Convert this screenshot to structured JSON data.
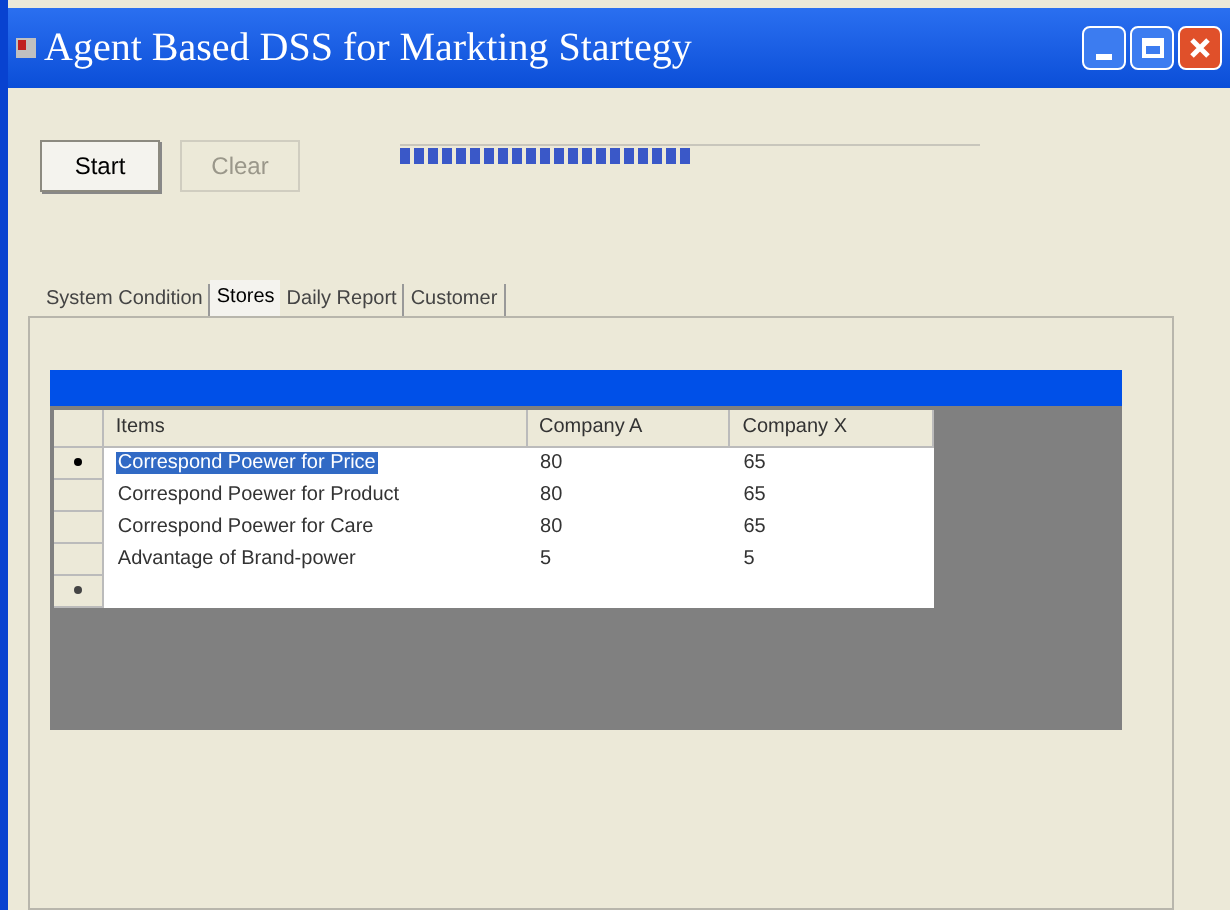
{
  "window": {
    "title": "Agent Based DSS for Markting Startegy"
  },
  "buttons": [
    {
      "label": "Start",
      "disabled": false
    },
    {
      "label": "Clear",
      "disabled": true
    }
  ],
  "progress": {
    "level": 0.5
  },
  "tabs": [
    {
      "label": "System Condition",
      "selected": false
    },
    {
      "label": "Stores",
      "selected": true
    },
    {
      "label": "Daily Report",
      "selected": false
    },
    {
      "label": "Customer",
      "selected": false
    }
  ],
  "table": {
    "columns": [
      "Items",
      "Company A",
      "Company X"
    ],
    "rows": [
      {
        "cells": [
          "Correspond Poewer for Price",
          "80",
          "65"
        ],
        "selected": true
      },
      {
        "cells": [
          "Correspond Poewer for Product",
          "80",
          "65"
        ],
        "selected": false
      },
      {
        "cells": [
          "Correspond Poewer for Care",
          "80",
          "65"
        ],
        "selected": false
      },
      {
        "cells": [
          "Advantage of Brand-power",
          "5",
          "5"
        ],
        "selected": false
      }
    ]
  }
}
